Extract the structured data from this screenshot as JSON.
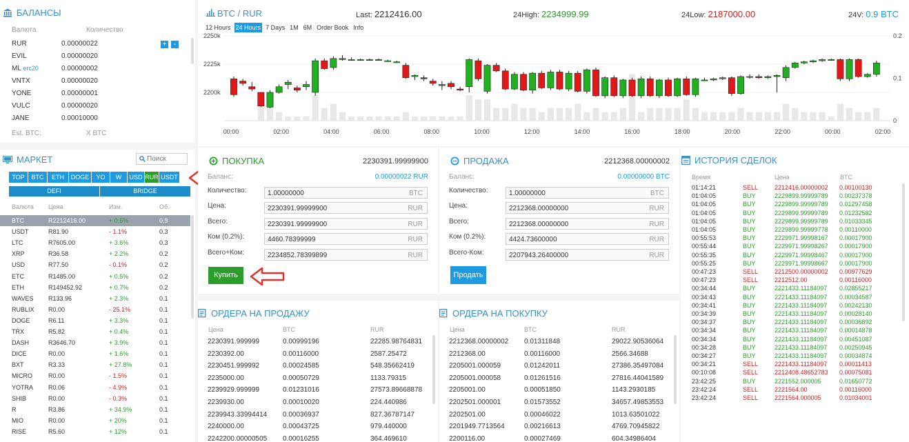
{
  "balances": {
    "title": "БАЛАНСЫ",
    "col_currency": "Валюта",
    "col_amount": "Количество",
    "rows": [
      {
        "cur": "RUR",
        "sub": "",
        "amt": "0.00000022"
      },
      {
        "cur": "EVIL",
        "sub": "",
        "amt": "0.00000020"
      },
      {
        "cur": "ML",
        "sub": "erc20",
        "amt": "0.00000002"
      },
      {
        "cur": "VNTX",
        "sub": "",
        "amt": "0.00000020"
      },
      {
        "cur": "YONE",
        "sub": "",
        "amt": "0.00000001"
      },
      {
        "cur": "VULC",
        "sub": "",
        "amt": "0.00000020"
      },
      {
        "cur": "JANE",
        "sub": "",
        "amt": "0.00010000"
      }
    ],
    "est_label": "Est. BTC:",
    "est_value": "X BTC",
    "plus": "+",
    "minus": "-"
  },
  "market": {
    "title": "МАРКЕТ",
    "search_placeholder": "Поиск",
    "tabs": [
      "TOP",
      "BTC",
      "ETH",
      "DOGE",
      "YO",
      "W",
      "USD",
      "RUR",
      "USDT"
    ],
    "active_tab": "RUR",
    "subtabs": [
      "DEFI",
      "BRIDGE"
    ],
    "cols": [
      "Валюта",
      "Цена",
      "Изм.",
      "Об."
    ],
    "rows": [
      {
        "cur": "BTC",
        "price": "R2212416.00",
        "chg": "+ 0.5%",
        "vol": "0.9",
        "up": true
      },
      {
        "cur": "USDT",
        "price": "R81.90",
        "chg": "- 1.1%",
        "vol": "0.3",
        "up": false
      },
      {
        "cur": "LTC",
        "price": "R7605.00",
        "chg": "+ 3.6%",
        "vol": "0.3",
        "up": true
      },
      {
        "cur": "XRP",
        "price": "R36.58",
        "chg": "+ 2.2%",
        "vol": "0.2",
        "up": true
      },
      {
        "cur": "USD",
        "price": "R77.50",
        "chg": "- 0.1%",
        "vol": "0.2",
        "up": false
      },
      {
        "cur": "ETC",
        "price": "R1485.00",
        "chg": "+ 0.5%",
        "vol": "0.2",
        "up": true
      },
      {
        "cur": "ETH",
        "price": "R149452.92",
        "chg": "+ 0.7%",
        "vol": "0.2",
        "up": true
      },
      {
        "cur": "WAVES",
        "price": "R133.96",
        "chg": "+ 2.3%",
        "vol": "0.1",
        "up": true
      },
      {
        "cur": "RUBLIX",
        "price": "R0.00",
        "chg": "- 25.1%",
        "vol": "0.1",
        "up": false
      },
      {
        "cur": "DOGE",
        "price": "R6.11",
        "chg": "+ 3.3%",
        "vol": "0.1",
        "up": true
      },
      {
        "cur": "TRX",
        "price": "R5.82",
        "chg": "+ 0.4%",
        "vol": "0.1",
        "up": true
      },
      {
        "cur": "DASH",
        "price": "R3646.70",
        "chg": "+ 3.9%",
        "vol": "0.1",
        "up": true
      },
      {
        "cur": "DICE",
        "price": "R0.00",
        "chg": "+ 1.6%",
        "vol": "0.1",
        "up": true
      },
      {
        "cur": "BXT",
        "price": "R3.33",
        "chg": "+ 27.8%",
        "vol": "0.1",
        "up": true
      },
      {
        "cur": "MICRO",
        "price": "R0.00",
        "chg": "- 1.5%",
        "vol": "0.1",
        "up": false
      },
      {
        "cur": "YOTRA",
        "price": "R0.06",
        "chg": "- 4.9%",
        "vol": "0.1",
        "up": false
      },
      {
        "cur": "SHIB",
        "price": "R0.00",
        "chg": "- 0.3%",
        "vol": "0.1",
        "up": false
      },
      {
        "cur": "R",
        "price": "R3.86",
        "chg": "+ 34.9%",
        "vol": "0.1",
        "up": true
      },
      {
        "cur": "MIO",
        "price": "R0.00",
        "chg": "+ 20%",
        "vol": "0.1",
        "up": true
      },
      {
        "cur": "RISE",
        "price": "R5.60",
        "chg": "+ 12%",
        "vol": "0.1",
        "up": true
      }
    ]
  },
  "chart_header": {
    "pair_base": "BTC",
    "pair_sep": " / ",
    "pair_quote": "RUR",
    "last_label": "Last: ",
    "last_value": "2212416.00",
    "high_label": "24High: ",
    "high_value": "2234999.99",
    "low_label": "24Low: ",
    "low_value": "2187000.00",
    "vol_label": "24V: ",
    "vol_value": "0.9 BTC",
    "tabs": [
      "12 Hours",
      "24 Hours",
      "7 Days",
      "1M",
      "6M",
      "Order Book",
      "Info"
    ],
    "active_tab": "24 Hours"
  },
  "chart_data": {
    "type": "candlestick",
    "x_ticks": [
      "00:00",
      "02:00",
      "04:00",
      "06:00",
      "08:00",
      "10:00",
      "12:00",
      "14:00",
      "16:00",
      "18:00",
      "20:00",
      "22:00",
      "00:00",
      "02:00"
    ],
    "y_ticks_left": [
      "2250k",
      "2225k",
      "2200k"
    ],
    "y_ticks_right": [
      "0.2",
      "0.1",
      "0"
    ],
    "y_range": [
      2175000,
      2250000
    ],
    "vol_range": [
      0,
      0.2
    ],
    "candles": [
      {
        "o": 2212000,
        "h": 2214000,
        "l": 2196000,
        "c": 2198000,
        "v": 0
      },
      {
        "o": 2210000,
        "h": 2212000,
        "l": 2206000,
        "c": 2208000,
        "v": 0
      },
      {
        "o": 2205000,
        "h": 2209000,
        "l": 2201000,
        "c": 2203000,
        "v": 0
      },
      {
        "o": 2200000,
        "h": 2200000,
        "l": 2187000,
        "c": 2188000,
        "v": 0.04
      },
      {
        "o": 2187000,
        "h": 2202000,
        "l": 2186000,
        "c": 2200000,
        "v": 0.05
      },
      {
        "o": 2200000,
        "h": 2207000,
        "l": 2199000,
        "c": 2205000,
        "v": 0.02
      },
      {
        "o": 2207000,
        "h": 2211000,
        "l": 2203000,
        "c": 2209000,
        "v": 0.01
      },
      {
        "o": 2204000,
        "h": 2206000,
        "l": 2200000,
        "c": 2202000,
        "v": 0.01
      },
      {
        "o": 2205000,
        "h": 2210000,
        "l": 2202000,
        "c": 2207000,
        "v": 0.01
      },
      {
        "o": 2200000,
        "h": 2230000,
        "l": 2197000,
        "c": 2228000,
        "v": 0.06
      },
      {
        "o": 2228000,
        "h": 2230000,
        "l": 2220000,
        "c": 2221000,
        "v": 0.03
      },
      {
        "o": 2222000,
        "h": 2232000,
        "l": 2220000,
        "c": 2230000,
        "v": 0.04
      },
      {
        "o": 2229000,
        "h": 2233000,
        "l": 2228000,
        "c": 2230000,
        "v": 0.02
      },
      {
        "o": 2229000,
        "h": 2231000,
        "l": 2228000,
        "c": 2229000,
        "v": 0.01
      },
      {
        "o": 2229000,
        "h": 2230000,
        "l": 2228000,
        "c": 2229000,
        "v": 0.01
      },
      {
        "o": 2229000,
        "h": 2230000,
        "l": 2228000,
        "c": 2229000,
        "v": 0.01
      },
      {
        "o": 2229000,
        "h": 2230000,
        "l": 2228000,
        "c": 2229000,
        "v": 0.01
      },
      {
        "o": 2228000,
        "h": 2229000,
        "l": 2227000,
        "c": 2228000,
        "v": 0.01
      },
      {
        "o": 2227000,
        "h": 2228000,
        "l": 2226000,
        "c": 2227000,
        "v": 0.01
      },
      {
        "o": 2224000,
        "h": 2226000,
        "l": 2212000,
        "c": 2213000,
        "v": 0.02
      },
      {
        "o": 2214000,
        "h": 2216000,
        "l": 2211000,
        "c": 2215000,
        "v": 0.01
      },
      {
        "o": 2213000,
        "h": 2215000,
        "l": 2210000,
        "c": 2212000,
        "v": 0.01
      },
      {
        "o": 2210000,
        "h": 2212000,
        "l": 2206000,
        "c": 2208000,
        "v": 0.01
      },
      {
        "o": 2206000,
        "h": 2210000,
        "l": 2202000,
        "c": 2207000,
        "v": 0.01
      },
      {
        "o": 2208000,
        "h": 2210000,
        "l": 2203000,
        "c": 2205000,
        "v": 0.01
      },
      {
        "o": 2203000,
        "h": 2205000,
        "l": 2201000,
        "c": 2202000,
        "v": 0.01
      },
      {
        "o": 2205000,
        "h": 2230000,
        "l": 2200000,
        "c": 2229000,
        "v": 0.06
      },
      {
        "o": 2228000,
        "h": 2230000,
        "l": 2210000,
        "c": 2212000,
        "v": 0.05
      },
      {
        "o": 2201000,
        "h": 2225000,
        "l": 2199000,
        "c": 2224000,
        "v": 0.05
      },
      {
        "o": 2224000,
        "h": 2226000,
        "l": 2218000,
        "c": 2219000,
        "v": 0.03
      },
      {
        "o": 2219000,
        "h": 2221000,
        "l": 2202000,
        "c": 2203000,
        "v": 0.03
      },
      {
        "o": 2203000,
        "h": 2218000,
        "l": 2202000,
        "c": 2216000,
        "v": 0.04
      },
      {
        "o": 2216000,
        "h": 2218000,
        "l": 2201000,
        "c": 2202000,
        "v": 0.03
      },
      {
        "o": 2202000,
        "h": 2218000,
        "l": 2199000,
        "c": 2217000,
        "v": 0.03
      },
      {
        "o": 2217000,
        "h": 2219000,
        "l": 2203000,
        "c": 2204000,
        "v": 0.02
      },
      {
        "o": 2204000,
        "h": 2220000,
        "l": 2202000,
        "c": 2218000,
        "v": 0.03
      },
      {
        "o": 2218000,
        "h": 2220000,
        "l": 2202000,
        "c": 2203000,
        "v": 0.03
      },
      {
        "o": 2203000,
        "h": 2219000,
        "l": 2201000,
        "c": 2217000,
        "v": 0.03
      },
      {
        "o": 2217000,
        "h": 2219000,
        "l": 2200000,
        "c": 2201000,
        "v": 0.04
      },
      {
        "o": 2201000,
        "h": 2221000,
        "l": 2199000,
        "c": 2220000,
        "v": 0.02
      },
      {
        "o": 2220000,
        "h": 2222000,
        "l": 2196000,
        "c": 2197000,
        "v": 0.03
      },
      {
        "o": 2197000,
        "h": 2214000,
        "l": 2195000,
        "c": 2213000,
        "v": 0.02
      },
      {
        "o": 2213000,
        "h": 2215000,
        "l": 2196000,
        "c": 2197000,
        "v": 0.02
      },
      {
        "o": 2197000,
        "h": 2212000,
        "l": 2195000,
        "c": 2211000,
        "v": 0.03
      },
      {
        "o": 2211000,
        "h": 2213000,
        "l": 2196000,
        "c": 2197000,
        "v": 0.11
      },
      {
        "o": 2197000,
        "h": 2214000,
        "l": 2195000,
        "c": 2212000,
        "v": 0.02
      },
      {
        "o": 2212000,
        "h": 2214000,
        "l": 2196000,
        "c": 2197000,
        "v": 0.03
      },
      {
        "o": 2197000,
        "h": 2212000,
        "l": 2195000,
        "c": 2211000,
        "v": 0.03
      },
      {
        "o": 2211000,
        "h": 2213000,
        "l": 2196000,
        "c": 2197000,
        "v": 0.03
      },
      {
        "o": 2197000,
        "h": 2213000,
        "l": 2196000,
        "c": 2212000,
        "v": 0.03
      },
      {
        "o": 2212000,
        "h": 2214000,
        "l": 2197000,
        "c": 2198000,
        "v": 0.05
      },
      {
        "o": 2198000,
        "h": 2213000,
        "l": 2196000,
        "c": 2212000,
        "v": 0.03
      },
      {
        "o": 2211000,
        "h": 2213000,
        "l": 2210000,
        "c": 2211000,
        "v": 0.02
      },
      {
        "o": 2211000,
        "h": 2213000,
        "l": 2210000,
        "c": 2212000,
        "v": 0.02
      },
      {
        "o": 2212000,
        "h": 2214000,
        "l": 2211000,
        "c": 2213000,
        "v": 0.02
      },
      {
        "o": 2213000,
        "h": 2214000,
        "l": 2197000,
        "c": 2199000,
        "v": 0.02
      },
      {
        "o": 2199000,
        "h": 2215000,
        "l": 2198000,
        "c": 2214000,
        "v": 0.03
      },
      {
        "o": 2214000,
        "h": 2216000,
        "l": 2212000,
        "c": 2214000,
        "v": 0.02
      },
      {
        "o": 2214000,
        "h": 2216000,
        "l": 2212000,
        "c": 2213000,
        "v": 0.02
      },
      {
        "o": 2213000,
        "h": 2215000,
        "l": 2212000,
        "c": 2214000,
        "v": 0.02
      },
      {
        "o": 2214000,
        "h": 2216000,
        "l": 2200000,
        "c": 2215000,
        "v": 0.02
      },
      {
        "o": 2213000,
        "h": 2224000,
        "l": 2210000,
        "c": 2222000,
        "v": 0.04
      },
      {
        "o": 2222000,
        "h": 2227000,
        "l": 2221000,
        "c": 2226000,
        "v": 0.03
      },
      {
        "o": 2226000,
        "h": 2228000,
        "l": 2225000,
        "c": 2227000,
        "v": 0.02
      },
      {
        "o": 2227000,
        "h": 2229000,
        "l": 2226000,
        "c": 2228000,
        "v": 0.02
      },
      {
        "o": 2228000,
        "h": 2230000,
        "l": 2227000,
        "c": 2229000,
        "v": 0.02
      },
      {
        "o": 2229000,
        "h": 2230000,
        "l": 2228000,
        "c": 2229000,
        "v": 0.01
      },
      {
        "o": 2229000,
        "h": 2230000,
        "l": 2210000,
        "c": 2212000,
        "v": 0.04
      },
      {
        "o": 2212000,
        "h": 2230000,
        "l": 2210000,
        "c": 2229000,
        "v": 0.03
      },
      {
        "o": 2229000,
        "h": 2230000,
        "l": 2213000,
        "c": 2214000,
        "v": 0.02
      },
      {
        "o": 2214000,
        "h": 2217000,
        "l": 2213000,
        "c": 2216000,
        "v": 0.02
      },
      {
        "o": 2216000,
        "h": 2228000,
        "l": 2214000,
        "c": 2226000,
        "v": 0.03
      }
    ]
  },
  "buy": {
    "title": "ПОКУПКА",
    "price_top": "2230391.99999900",
    "balance_label": "Баланс:",
    "balance_value": "0.00000022 RUR",
    "fields": [
      {
        "label": "Количество:",
        "value": "1.00000000",
        "unit": "BTC"
      },
      {
        "label": "Цена:",
        "value": "2230391.99999900",
        "unit": "RUR"
      },
      {
        "label": "Всего:",
        "value": "2230391.99999900",
        "unit": "RUR"
      },
      {
        "label": "Ком (0.2%):",
        "value": "4460.78399999",
        "unit": "RUR"
      },
      {
        "label": "Всего+Ком:",
        "value": "2234852.78399899",
        "unit": "RUR"
      }
    ],
    "button": "Купить"
  },
  "sell": {
    "title": "ПРОДАЖА",
    "price_top": "2212368.00000002",
    "balance_label": "Баланс:",
    "balance_value": "0.00000000 BTC",
    "fields": [
      {
        "label": "Количество:",
        "value": "1.00000000",
        "unit": "BTC"
      },
      {
        "label": "Цена:",
        "value": "2212368.00000000",
        "unit": "RUR"
      },
      {
        "label": "Всего:",
        "value": "2212368.00000000",
        "unit": "RUR"
      },
      {
        "label": "Ком (0.2%):",
        "value": "4424.73600000",
        "unit": "RUR"
      },
      {
        "label": "Всего-Ком:",
        "value": "2207943.26400000",
        "unit": "RUR"
      }
    ],
    "button": "Продать"
  },
  "sell_orders": {
    "title": "ОРДЕРА НА ПРОДАЖУ",
    "cols": [
      "Цена",
      "BTC",
      "RUR"
    ],
    "rows": [
      [
        "2230391.999999",
        "0.00999196",
        "22285.98764831"
      ],
      [
        "2230392.00",
        "0.00116000",
        "2587.25472"
      ],
      [
        "2230451.999992",
        "0.00024585",
        "548.35662419"
      ],
      [
        "2235000.00",
        "0.00050729",
        "1133.79315"
      ],
      [
        "2239929.999999",
        "0.01231016",
        "27573.89668878"
      ],
      [
        "2239930.00",
        "0.00010020",
        "224.440986"
      ],
      [
        "2239943.33994414",
        "0.00036937",
        "827.36787147"
      ],
      [
        "2240000.00",
        "0.00043725",
        "979.440000"
      ],
      [
        "2242200.00000505",
        "0.00016255",
        "364.469610"
      ]
    ]
  },
  "buy_orders": {
    "title": "ОРДЕРА НА ПОКУПКУ",
    "cols": [
      "Цена",
      "BTC",
      "RUR"
    ],
    "rows": [
      [
        "2212368.00000002",
        "0.01311848",
        "29022.90536064"
      ],
      [
        "2212368.00",
        "0.00116000",
        "2566.34688"
      ],
      [
        "2205001.000059",
        "0.01242011",
        "27386.35497084"
      ],
      [
        "2205001.000058",
        "0.01261516",
        "27816.44041589"
      ],
      [
        "2205001.00",
        "0.00051850",
        "1143.2930185"
      ],
      [
        "2202501.000001",
        "0.01573552",
        "34657.49853553"
      ],
      [
        "2202501.00",
        "0.00046022",
        "1013.63501022"
      ],
      [
        "2201949.7713564",
        "0.00216613",
        "4769.70945822"
      ],
      [
        "2200116.00",
        "0.00027469",
        "604.34986404"
      ]
    ]
  },
  "history": {
    "title": "ИСТОРИЯ СДЕЛОК",
    "cols": [
      "Время",
      "Цена",
      "BTC"
    ],
    "rows": [
      [
        "01:14:21",
        "SELL",
        "2212416.00000002",
        "0.00100130"
      ],
      [
        "01:04:05",
        "BUY",
        "2229899.99999789",
        "0.00237378"
      ],
      [
        "01:04:05",
        "BUY",
        "2229899.99999789",
        "0.01297458"
      ],
      [
        "01:04:05",
        "BUY",
        "2229899.99999789",
        "0.01232582"
      ],
      [
        "01:04:05",
        "BUY",
        "2229899.99999789",
        "0.01033345"
      ],
      [
        "01:04:05",
        "BUY",
        "2229899.99999778",
        "0.00110000"
      ],
      [
        "00:55:53",
        "BUY",
        "2229971.99998167",
        "0.00017900"
      ],
      [
        "00:55:44",
        "BUY",
        "2229971.99998267",
        "0.00017900"
      ],
      [
        "00:55:35",
        "BUY",
        "2229971.99998467",
        "0.00017900"
      ],
      [
        "00:55:25",
        "BUY",
        "2229971.99998667",
        "0.00017900"
      ],
      [
        "00:47:23",
        "SELL",
        "2212500.00000002",
        "0.00977629"
      ],
      [
        "00:47:23",
        "SELL",
        "2212512.00",
        "0.00116000"
      ],
      [
        "00:34:44",
        "BUY",
        "2221433.11184097",
        "0.02855217"
      ],
      [
        "00:34:43",
        "BUY",
        "2221433.11184097",
        "0.00034587"
      ],
      [
        "00:34:41",
        "BUY",
        "2221433.11184097",
        "0.00242130"
      ],
      [
        "00:34:39",
        "BUY",
        "2221433.11184097",
        "0.00028140"
      ],
      [
        "00:34:37",
        "BUY",
        "2221433.11184097",
        "0.00036892"
      ],
      [
        "00:34:34",
        "BUY",
        "2221433.11184097",
        "0.00014878"
      ],
      [
        "00:34:34",
        "BUY",
        "2221433.11184097",
        "0.00451087"
      ],
      [
        "00:34:28",
        "BUY",
        "2221433.11184097",
        "0.00250945"
      ],
      [
        "00:34:27",
        "BUY",
        "2221433.11184097",
        "0.00034874"
      ],
      [
        "00:34:21",
        "SELL",
        "2221433.11184097",
        "0.00011413"
      ],
      [
        "00:10:08",
        "SELL",
        "2212408.48652783",
        "0.00075081"
      ],
      [
        "23:42:25",
        "BUY",
        "2221552.000005",
        "0.01650772"
      ],
      [
        "23:42:24",
        "SELL",
        "2221564.00",
        "0.00116000"
      ],
      [
        "23:42:24",
        "SELL",
        "2221564.000005",
        "0.01034001"
      ]
    ]
  },
  "colors": {
    "accent": "#1e9ae0",
    "green": "#2a9d2a",
    "red": "#d02020",
    "arrow": "#e0312c"
  }
}
